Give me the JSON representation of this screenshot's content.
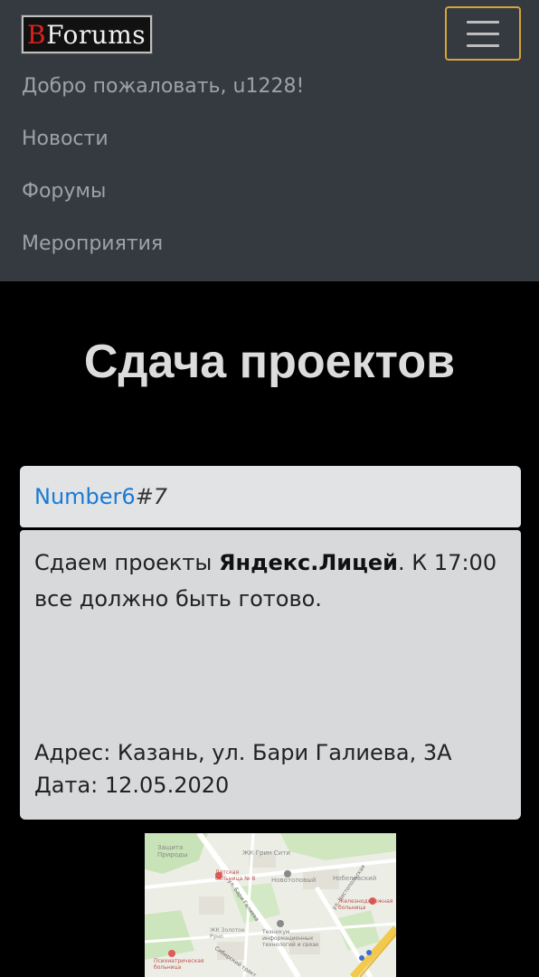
{
  "brand": {
    "first_letter": "B",
    "rest": "Forums"
  },
  "nav": {
    "welcome": "Добро пожаловать, u1228!",
    "items": [
      "Новости",
      "Форумы",
      "Мероприятия"
    ]
  },
  "page": {
    "title": "Сдача проектов"
  },
  "post": {
    "author": "Number6",
    "number": "#7",
    "text_before": "Сдаем проекты ",
    "text_bold": "Яндекс.Лицей",
    "text_after": ". К 17:00 все должно быть готово.",
    "address": "Адрес: Казань, ул. Бари Галиева, 3А",
    "date": "Дата: 12.05.2020"
  },
  "map": {
    "labels": [
      "Защита Природы",
      "ЖК Грин Сити",
      "Новотоповый",
      "Нобелевский",
      "Детская больница № 8",
      "Железнодорожная больница",
      "Техникум информационных технологий и связи",
      "ЖК Золотое Руно",
      "Психиатрическая больница",
      "ул. Бари Галиева",
      "ул. Чистопольская",
      "Сибирский тракт"
    ],
    "colors": {
      "road": "#ffffff",
      "park": "#c9e3b8",
      "block": "#e6e4dc",
      "highway": "#f2c94c",
      "medical": "#e05a5a"
    }
  }
}
